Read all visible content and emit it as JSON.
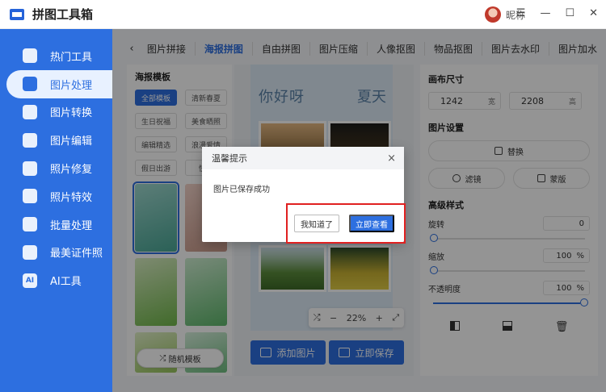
{
  "app": {
    "title": "拼图工具箱",
    "user_name": "昵称",
    "win_controls": [
      "☰",
      "—",
      "☐",
      "✕"
    ]
  },
  "sidebar": {
    "items": [
      {
        "label": "热门工具",
        "icon": "hot-tools-icon"
      },
      {
        "label": "图片处理",
        "icon": "image-process-icon"
      },
      {
        "label": "图片转换",
        "icon": "image-convert-icon"
      },
      {
        "label": "图片编辑",
        "icon": "image-edit-icon"
      },
      {
        "label": "照片修复",
        "icon": "photo-repair-icon"
      },
      {
        "label": "照片特效",
        "icon": "photo-effect-icon"
      },
      {
        "label": "批量处理",
        "icon": "batch-process-icon"
      },
      {
        "label": "最美证件照",
        "icon": "id-photo-icon"
      },
      {
        "label": "AI工具",
        "icon": "ai-tools-icon",
        "glyph": "AI"
      }
    ],
    "active": 1
  },
  "tabs": {
    "back": "‹",
    "items": [
      "图片拼接",
      "海报拼图",
      "自由拼图",
      "图片压缩",
      "人像抠图",
      "物品抠图",
      "图片去水印",
      "图片加水"
    ],
    "active": 1
  },
  "templates": {
    "heading": "海报模板",
    "chips": [
      "全部模板",
      "清新春夏",
      "生日祝福",
      "美食晒照",
      "编辑精选",
      "浪漫爱情",
      "假日出游",
      "快乐"
    ],
    "random_button": "随机模板"
  },
  "poster": {
    "title_left": "你好呀",
    "title_right": "夏天"
  },
  "zoom": {
    "shuffle": "⤮",
    "minus": "−",
    "value": "22%",
    "plus": "+",
    "fit": "⤢"
  },
  "canvas_buttons": {
    "add_image": "添加图片",
    "save_now": "立即保存"
  },
  "right_panel": {
    "canvas_size_heading": "画布尺寸",
    "width": "1242",
    "width_unit": "宽",
    "height": "2208",
    "height_unit": "高",
    "image_settings_heading": "图片设置",
    "replace": "替换",
    "filter": "滤镜",
    "mask": "蒙版",
    "advanced_heading": "高级样式",
    "rotate_label": "旋转",
    "rotate_value": "0",
    "scale_label": "缩放",
    "scale_value": "100",
    "scale_unit": "%",
    "opacity_label": "不透明度",
    "opacity_value": "100",
    "opacity_unit": "%"
  },
  "dialog": {
    "title": "温馨提示",
    "close": "×",
    "message": "图片已保存成功",
    "ok_button": "我知道了",
    "view_button": "立即查看"
  },
  "colors": {
    "brand": "#2d6fe0",
    "highlight": "#e02020"
  }
}
